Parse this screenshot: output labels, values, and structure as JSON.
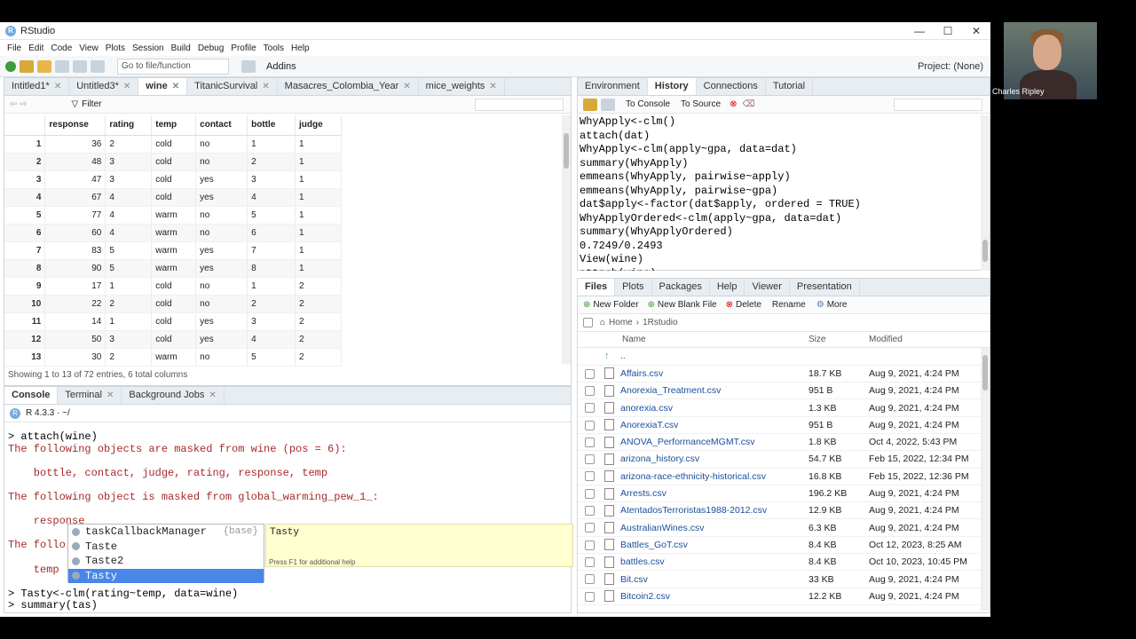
{
  "window": {
    "title": "RStudio",
    "min": "—",
    "max": "☐",
    "close": "✕"
  },
  "menu": [
    "File",
    "Edit",
    "Code",
    "View",
    "Plots",
    "Session",
    "Build",
    "Debug",
    "Profile",
    "Tools",
    "Help"
  ],
  "toolbar": {
    "goto_placeholder": "Go to file/function",
    "addins": "Addins",
    "project": "Project: (None)"
  },
  "source_tabs": [
    {
      "label": "Intitled1*"
    },
    {
      "label": "Untitled3*"
    },
    {
      "label": "wine",
      "active": true
    },
    {
      "label": "TitanicSurvival"
    },
    {
      "label": "Masacres_Colombia_Year"
    },
    {
      "label": "mice_weights"
    }
  ],
  "viewer": {
    "filter_label": "Filter",
    "columns": [
      "response",
      "rating",
      "temp",
      "contact",
      "bottle",
      "judge"
    ],
    "rows": [
      [
        "1",
        "36",
        "2",
        "cold",
        "no",
        "1",
        "1"
      ],
      [
        "2",
        "48",
        "3",
        "cold",
        "no",
        "2",
        "1"
      ],
      [
        "3",
        "47",
        "3",
        "cold",
        "yes",
        "3",
        "1"
      ],
      [
        "4",
        "67",
        "4",
        "cold",
        "yes",
        "4",
        "1"
      ],
      [
        "5",
        "77",
        "4",
        "warm",
        "no",
        "5",
        "1"
      ],
      [
        "6",
        "60",
        "4",
        "warm",
        "no",
        "6",
        "1"
      ],
      [
        "7",
        "83",
        "5",
        "warm",
        "yes",
        "7",
        "1"
      ],
      [
        "8",
        "90",
        "5",
        "warm",
        "yes",
        "8",
        "1"
      ],
      [
        "9",
        "17",
        "1",
        "cold",
        "no",
        "1",
        "2"
      ],
      [
        "10",
        "22",
        "2",
        "cold",
        "no",
        "2",
        "2"
      ],
      [
        "11",
        "14",
        "1",
        "cold",
        "yes",
        "3",
        "2"
      ],
      [
        "12",
        "50",
        "3",
        "cold",
        "yes",
        "4",
        "2"
      ],
      [
        "13",
        "30",
        "2",
        "warm",
        "no",
        "5",
        "2"
      ]
    ],
    "status": "Showing 1 to 13 of 72 entries, 6 total columns"
  },
  "console_tabs": [
    {
      "label": "Console",
      "active": true
    },
    {
      "label": "Terminal"
    },
    {
      "label": "Background Jobs"
    }
  ],
  "console": {
    "version": "R 4.3.3 · ~/",
    "lines": [
      {
        "t": "> attach(wine)",
        "c": "p"
      },
      {
        "t": "The following objects are masked from wine (pos = 6):",
        "c": "m"
      },
      {
        "t": "",
        "c": "p"
      },
      {
        "t": "    bottle, contact, judge, rating, response, temp",
        "c": "m"
      },
      {
        "t": "",
        "c": "p"
      },
      {
        "t": "The following object is masked from global_warming_pew_1_:",
        "c": "m"
      },
      {
        "t": "",
        "c": "p"
      },
      {
        "t": "    response",
        "c": "m"
      },
      {
        "t": "",
        "c": "p"
      },
      {
        "t": "The follo",
        "c": "m"
      },
      {
        "t": "",
        "c": "p"
      },
      {
        "t": "    temp",
        "c": "m"
      },
      {
        "t": "",
        "c": "p"
      },
      {
        "t": "> Tasty<-clm(rating~temp, data=wine)",
        "c": "p"
      },
      {
        "t": "> summary(tas)",
        "c": "p"
      }
    ]
  },
  "autocomplete": {
    "items": [
      {
        "label": "taskCallbackManager",
        "source": "{base}"
      },
      {
        "label": "Taste",
        "source": ""
      },
      {
        "label": "Taste2",
        "source": ""
      },
      {
        "label": "Tasty",
        "source": "",
        "selected": true
      }
    ],
    "help_title": "Tasty",
    "help_hint": "Press F1 for additional help"
  },
  "env_tabs": [
    {
      "label": "Environment"
    },
    {
      "label": "History",
      "active": true
    },
    {
      "label": "Connections"
    },
    {
      "label": "Tutorial"
    }
  ],
  "history_toolbar": {
    "to_console": "To Console",
    "to_source": "To Source"
  },
  "history": [
    "WhyApply<-clm()",
    "attach(dat)",
    "WhyApply<-clm(apply~gpa, data=dat)",
    "summary(WhyApply)",
    "emmeans(WhyApply, pairwise~apply)",
    "emmeans(WhyApply, pairwise~gpa)",
    "dat$apply<-factor(dat$apply, ordered = TRUE)",
    "WhyApplyOrdered<-clm(apply~gpa, data=dat)",
    "summary(WhyApplyOrdered)",
    "0.7249/0.2493",
    "View(wine)",
    "attach(wine)"
  ],
  "files_tabs": [
    {
      "label": "Files",
      "active": true
    },
    {
      "label": "Plots"
    },
    {
      "label": "Packages"
    },
    {
      "label": "Help"
    },
    {
      "label": "Viewer"
    },
    {
      "label": "Presentation"
    }
  ],
  "files_toolbar": {
    "new_folder": "New Folder",
    "new_blank": "New Blank File",
    "delete": "Delete",
    "rename": "Rename",
    "more": "More"
  },
  "breadcrumb": {
    "home": "Home",
    "dir": "1Rstudio"
  },
  "files_cols": {
    "name": "Name",
    "size": "Size",
    "modified": "Modified"
  },
  "files": [
    {
      "name": "..",
      "size": "",
      "modified": ""
    },
    {
      "name": "Affairs.csv",
      "size": "18.7 KB",
      "modified": "Aug 9, 2021, 4:24 PM"
    },
    {
      "name": "Anorexia_Treatment.csv",
      "size": "951 B",
      "modified": "Aug 9, 2021, 4:24 PM"
    },
    {
      "name": "anorexia.csv",
      "size": "1.3 KB",
      "modified": "Aug 9, 2021, 4:24 PM"
    },
    {
      "name": "AnorexiaT.csv",
      "size": "951 B",
      "modified": "Aug 9, 2021, 4:24 PM"
    },
    {
      "name": "ANOVA_PerformanceMGMT.csv",
      "size": "1.8 KB",
      "modified": "Oct 4, 2022, 5:43 PM"
    },
    {
      "name": "arizona_history.csv",
      "size": "54.7 KB",
      "modified": "Feb 15, 2022, 12:34 PM"
    },
    {
      "name": "arizona-race-ethnicity-historical.csv",
      "size": "16.8 KB",
      "modified": "Feb 15, 2022, 12:36 PM"
    },
    {
      "name": "Arrests.csv",
      "size": "196.2 KB",
      "modified": "Aug 9, 2021, 4:24 PM"
    },
    {
      "name": "AtentadosTerroristas1988-2012.csv",
      "size": "12.9 KB",
      "modified": "Aug 9, 2021, 4:24 PM"
    },
    {
      "name": "AustralianWines.csv",
      "size": "6.3 KB",
      "modified": "Aug 9, 2021, 4:24 PM"
    },
    {
      "name": "Battles_GoT.csv",
      "size": "8.4 KB",
      "modified": "Oct 12, 2023, 8:25 AM"
    },
    {
      "name": "battles.csv",
      "size": "8.4 KB",
      "modified": "Oct 10, 2023, 10:45 PM"
    },
    {
      "name": "Bit.csv",
      "size": "33 KB",
      "modified": "Aug 9, 2021, 4:24 PM"
    },
    {
      "name": "Bitcoin2.csv",
      "size": "12.2 KB",
      "modified": "Aug 9, 2021, 4:24 PM"
    }
  ],
  "webcam": {
    "name": "Charles Ripley"
  }
}
